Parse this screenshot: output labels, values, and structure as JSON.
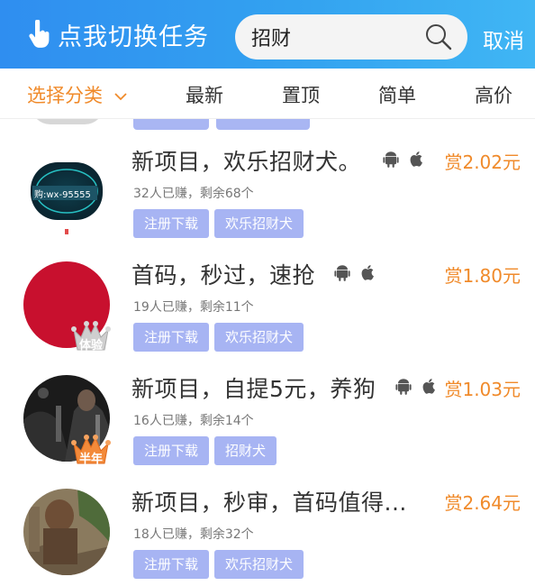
{
  "header": {
    "switch_label": "点我切换任务",
    "search": {
      "value": "招财",
      "placeholder": ""
    },
    "cancel_label": "取消"
  },
  "filters": [
    {
      "label": "选择分类",
      "active": true,
      "has_dropdown": true
    },
    {
      "label": "最新",
      "active": false
    },
    {
      "label": "置顶",
      "active": false
    },
    {
      "label": "简单",
      "active": false
    },
    {
      "label": "高价",
      "active": false
    }
  ],
  "tasks": [
    {
      "title": "新项目，欢乐招财犬。",
      "reward": "赏2.02元",
      "meta": "32人已赚，剩余68个",
      "tags": [
        "注册下载",
        "欢乐招财犬"
      ],
      "platforms": [
        "android-icon",
        "apple-icon"
      ],
      "avatar_text": "购:wx-95555",
      "badge": ""
    },
    {
      "title": "首码，秒过，速抢",
      "reward": "赏1.80元",
      "meta": "19人已赚，剩余11个",
      "tags": [
        "注册下载",
        "欢乐招财犬"
      ],
      "platforms": [
        "android-icon",
        "apple-icon"
      ],
      "avatar_text": "",
      "badge": "体验"
    },
    {
      "title": "新项目，自提5元，养狗",
      "reward": "赏1.03元",
      "meta": "16人已赚，剩余14个",
      "tags": [
        "注册下载",
        "招财犬"
      ],
      "platforms": [
        "android-icon",
        "apple-icon"
      ],
      "avatar_text": "",
      "badge": "半年"
    },
    {
      "title": "新项目，秒审，首码值得...",
      "reward": "赏2.64元",
      "meta": "18人已赚，剩余32个",
      "tags": [
        "注册下载",
        "欢乐招财犬"
      ],
      "platforms": [],
      "avatar_text": "",
      "badge": ""
    }
  ],
  "colors": {
    "header_start": "#2f8ef0",
    "header_end": "#40b6f4",
    "accent_orange": "#f08a2a",
    "tag_bg": "#a7b4f3"
  }
}
